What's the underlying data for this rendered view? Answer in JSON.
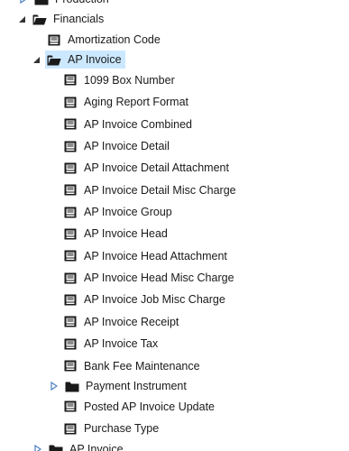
{
  "tree": {
    "nodes": [
      {
        "label": "Production",
        "type": "folder",
        "state": "collapsed"
      },
      {
        "label": "Financials",
        "type": "folder",
        "state": "expanded"
      },
      {
        "label": "Amortization Code",
        "type": "report"
      },
      {
        "label": "AP Invoice",
        "type": "folder",
        "state": "expanded",
        "selected": true
      },
      {
        "label": "1099 Box Number",
        "type": "report"
      },
      {
        "label": "Aging Report Format",
        "type": "report"
      },
      {
        "label": "AP Invoice Combined",
        "type": "report"
      },
      {
        "label": "AP Invoice Detail",
        "type": "report"
      },
      {
        "label": "AP Invoice Detail Attachment",
        "type": "report"
      },
      {
        "label": "AP Invoice Detail Misc Charge",
        "type": "report"
      },
      {
        "label": "AP Invoice Group",
        "type": "report"
      },
      {
        "label": "AP Invoice Head",
        "type": "report"
      },
      {
        "label": "AP Invoice Head Attachment",
        "type": "report"
      },
      {
        "label": "AP Invoice Head Misc Charge",
        "type": "report"
      },
      {
        "label": "AP Invoice Job Misc Charge",
        "type": "report"
      },
      {
        "label": "AP Invoice Receipt",
        "type": "report"
      },
      {
        "label": "AP Invoice Tax",
        "type": "report"
      },
      {
        "label": "Bank Fee Maintenance",
        "type": "report"
      },
      {
        "label": "Payment Instrument",
        "type": "folder",
        "state": "collapsed"
      },
      {
        "label": "Posted AP Invoice Update",
        "type": "report"
      },
      {
        "label": "Purchase Type",
        "type": "report"
      },
      {
        "label": "AP Invoice",
        "type": "folder",
        "state": "collapsed"
      }
    ]
  },
  "colors": {
    "selection": "#cce8ff",
    "toggle_collapsed": "#4a7fc1",
    "toggle_expanded": "#333333"
  }
}
